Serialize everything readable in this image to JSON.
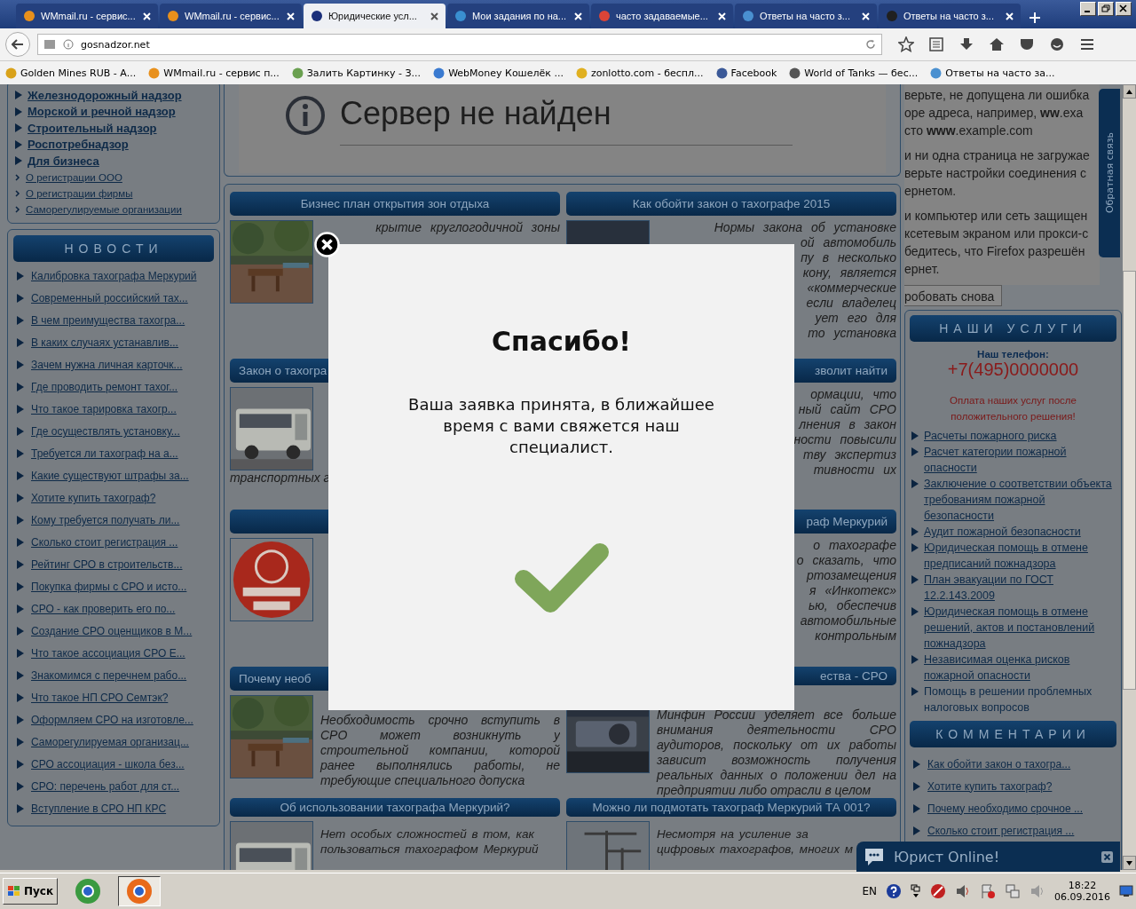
{
  "browser": {
    "tabs": [
      {
        "title": "WMmail.ru - сервис...",
        "selected": false,
        "color": "#e8901c"
      },
      {
        "title": "WMmail.ru - сервис...",
        "selected": false,
        "color": "#e8901c"
      },
      {
        "title": "Юридические усл...",
        "selected": true,
        "color": "#1a2f7a"
      },
      {
        "title": "Мои задания по на...",
        "selected": false,
        "color": "#3a8fd0"
      },
      {
        "title": "часто задаваемые...",
        "selected": false,
        "color": "#db4437"
      },
      {
        "title": "Ответы на часто з...",
        "selected": false,
        "color": "#4a90d0"
      },
      {
        "title": "Ответы на часто з...",
        "selected": false,
        "color": "#202020"
      }
    ],
    "address": "gosnadzor.net",
    "bookmarks": [
      {
        "title": "Golden Mines RUB - А...",
        "color": "#d9a21a"
      },
      {
        "title": "WMmail.ru - сервис п...",
        "color": "#e8901c"
      },
      {
        "title": "Залить Картинку - З...",
        "color": "#6aa050"
      },
      {
        "title": "WebMoney Кошелёк ...",
        "color": "#3a7ad0"
      },
      {
        "title": "zonlotto.com - беспл...",
        "color": "#e0b020"
      },
      {
        "title": "Facebook",
        "color": "#3b5998"
      },
      {
        "title": "World of Tanks — бес...",
        "color": "#555555"
      },
      {
        "title": "Ответы на часто за...",
        "color": "#4a90d0"
      }
    ]
  },
  "left_sidebar": {
    "menu": [
      {
        "text": "Железнодорожный надзор",
        "kind": "section"
      },
      {
        "text": "Морской и речной надзор",
        "kind": "section"
      },
      {
        "text": "Строительный надзор",
        "kind": "section"
      },
      {
        "text": "Роспотребнадзор",
        "kind": "section"
      },
      {
        "text": "Для бизнеса",
        "kind": "section"
      },
      {
        "text": "О регистрации ООО",
        "kind": "sub"
      },
      {
        "text": "О регистрации фирмы",
        "kind": "sub"
      },
      {
        "text": "Саморегулируемые организации",
        "kind": "sub"
      }
    ],
    "news_title": "НОВОСТИ",
    "news": [
      "Калибровка тахографа Меркурий",
      "Современный российский тах...",
      "В чем преимущества тахогра...",
      "В каких случаях устанавлив...",
      "Зачем нужна личная карточк...",
      "Где проводить ремонт тахог...",
      "Что такое тарировка тахогр...",
      "Где осуществлять установку...",
      "Требуется ли тахограф на а...",
      "Какие существуют штрафы за...",
      "Хотите купить тахограф?",
      "Кому требуется получать ли...",
      "Сколько стоит регистрация ...",
      "Рейтинг СРО в строительств...",
      "Покупка фирмы с СРО и исто...",
      "СРО - как проверить его по...",
      "Создание СРО оценщиков в М...",
      "Что такое ассоциация СРО Е...",
      "Знакомимся с перечнем рабо...",
      "Что такое НП СРО Семтэк?",
      "Оформляем СРО на изготовле...",
      "Саморегулируемая организац...",
      "СРО ассоциация - школа без...",
      "СРО: перечень работ для ст...",
      "Вступление в СРО НП КРС"
    ]
  },
  "error_page": {
    "title": "Сервер не найден",
    "paragraphs": [
      [
        "верьте, не допущена ли ошибка",
        "оре адреса, например, **ww**.exa",
        "сто **www**.example.com"
      ],
      [
        "и ни одна страница не загружае",
        "верьте настройки соединения с",
        "ернетом."
      ],
      [
        "и компьютер или сеть защищен",
        "ксетевым экраном или прокси-с",
        "бедитесь, что Firefox разрешён",
        "ернет."
      ]
    ],
    "retry_button": "робовать снова"
  },
  "cards": [
    {
      "title": "Бизнес план открытия зон отдыха",
      "title_cut": false,
      "image": {
        "kind": "picture"
      },
      "lines": [
        "крытие круглогодичной зоны"
      ]
    },
    {
      "title": "Как обойти закон о тахографе 2015",
      "title_cut": false,
      "image": {
        "kind": "picture"
      },
      "lines": [
        "Нормы закона об установке",
        "ой автомобиль",
        "пу в несколько",
        "кону, является",
        "«коммерческие",
        "если владелец",
        "ует его для",
        "то установка"
      ]
    },
    {
      "title": "Закон о тахогра",
      "title_cut": true,
      "image": {
        "kind": "picture"
      },
      "tail": [
        "транспортных г"
      ]
    },
    {
      "title": "зволит найти",
      "title_cut": true,
      "lines": [
        "ормации, что",
        "ный сайт СРО",
        "лнения в закон",
        "ности повысили",
        "тву экспертиз",
        "тивности их"
      ]
    },
    {
      "image": {
        "kind": "picture"
      }
    },
    {
      "title": "раф Меркурий",
      "title_cut": true,
      "lines": [
        "о тахографе",
        "о сказать, что",
        "ртозамещения",
        "я «Инкотекс»",
        "ью, обеспечив",
        "автомобильные",
        "контрольным"
      ]
    },
    {
      "title": "Почему необ",
      "title_cut": true,
      "image": {
        "kind": "picture"
      },
      "text": "Необходимость срочно вступить в СРО может возникнуть у строительной компании, которой ранее выполнялись работы, не требующие специального допуска"
    },
    {
      "title": "ества - СРО",
      "title_cut": true,
      "image": {
        "kind": "picture"
      },
      "text": "Минфин России уделяет все больше внимания деятельности СРО аудиторов, поскольку от их работы зависит возможность получения реальных данных о положении дел на предприятии либо отрасли в целом"
    },
    {
      "title": "Об использовании тахографа Меркурий?",
      "title_cut": false,
      "image": {
        "kind": "picture"
      },
      "text_lines": [
        "Нет особых сложностей в том, как",
        "пользоваться тахографом Меркурий"
      ]
    },
    {
      "title": "Можно ли подмотать тахограф Меркурий ТА 001?",
      "title_cut": false,
      "image": {
        "kind": "picture"
      },
      "text_lines": [
        "Несмотря на усиление за",
        "цифровых тахографов, многих м"
      ]
    }
  ],
  "right_sidebar": {
    "services_title": "НАШИ УСЛУГИ",
    "phone_label": "Наш телефон:",
    "phone": "+7(495)0000000",
    "payment_note": "Оплата наших услуг после положительного решения!",
    "services": [
      {
        "text": "Расчеты пожарного риска",
        "link": true
      },
      {
        "text": "Расчет категории пожарной опасности",
        "link": true
      },
      {
        "text": "Заключение о соответствии объекта требованиям пожарной безопасности",
        "link": true
      },
      {
        "text": "Аудит пожарной безопасности",
        "link": true
      },
      {
        "text": "Юридическая помощь в отмене предписаний пожнадзора",
        "link": true
      },
      {
        "text": "План эвакуации по ГОСТ 12.2.143.2009",
        "link": true
      },
      {
        "text": "Юридическая помощь в отмене решений, актов и постановлений пожнадзора",
        "link": true
      },
      {
        "text": "Независимая оценка рисков пожарной опасности",
        "link": true
      },
      {
        "text": "Помощь в решении проблемных налоговых вопросов",
        "link": false
      }
    ],
    "comments_title": "КОММЕНТАРИИ",
    "comments": [
      "Как обойти закон о тахогра...",
      "Хотите купить тахограф?",
      "Почему необходимо срочное ...",
      "Сколько стоит регистрация ..."
    ]
  },
  "feedback_tab": "Обратная связь",
  "chat": {
    "title": "Юрист Online!"
  },
  "modal": {
    "title": "Спасибо!",
    "message": "Ваша заявка принята, в ближайшее время с вами свяжется наш специалист."
  },
  "taskbar": {
    "start": "Пуск",
    "apps": [
      {
        "color": "#3a9a40",
        "selected": false
      },
      {
        "color": "#e86a1a",
        "selected": true
      }
    ],
    "language": "EN",
    "time": "18:22",
    "date": "06.09.2016"
  }
}
